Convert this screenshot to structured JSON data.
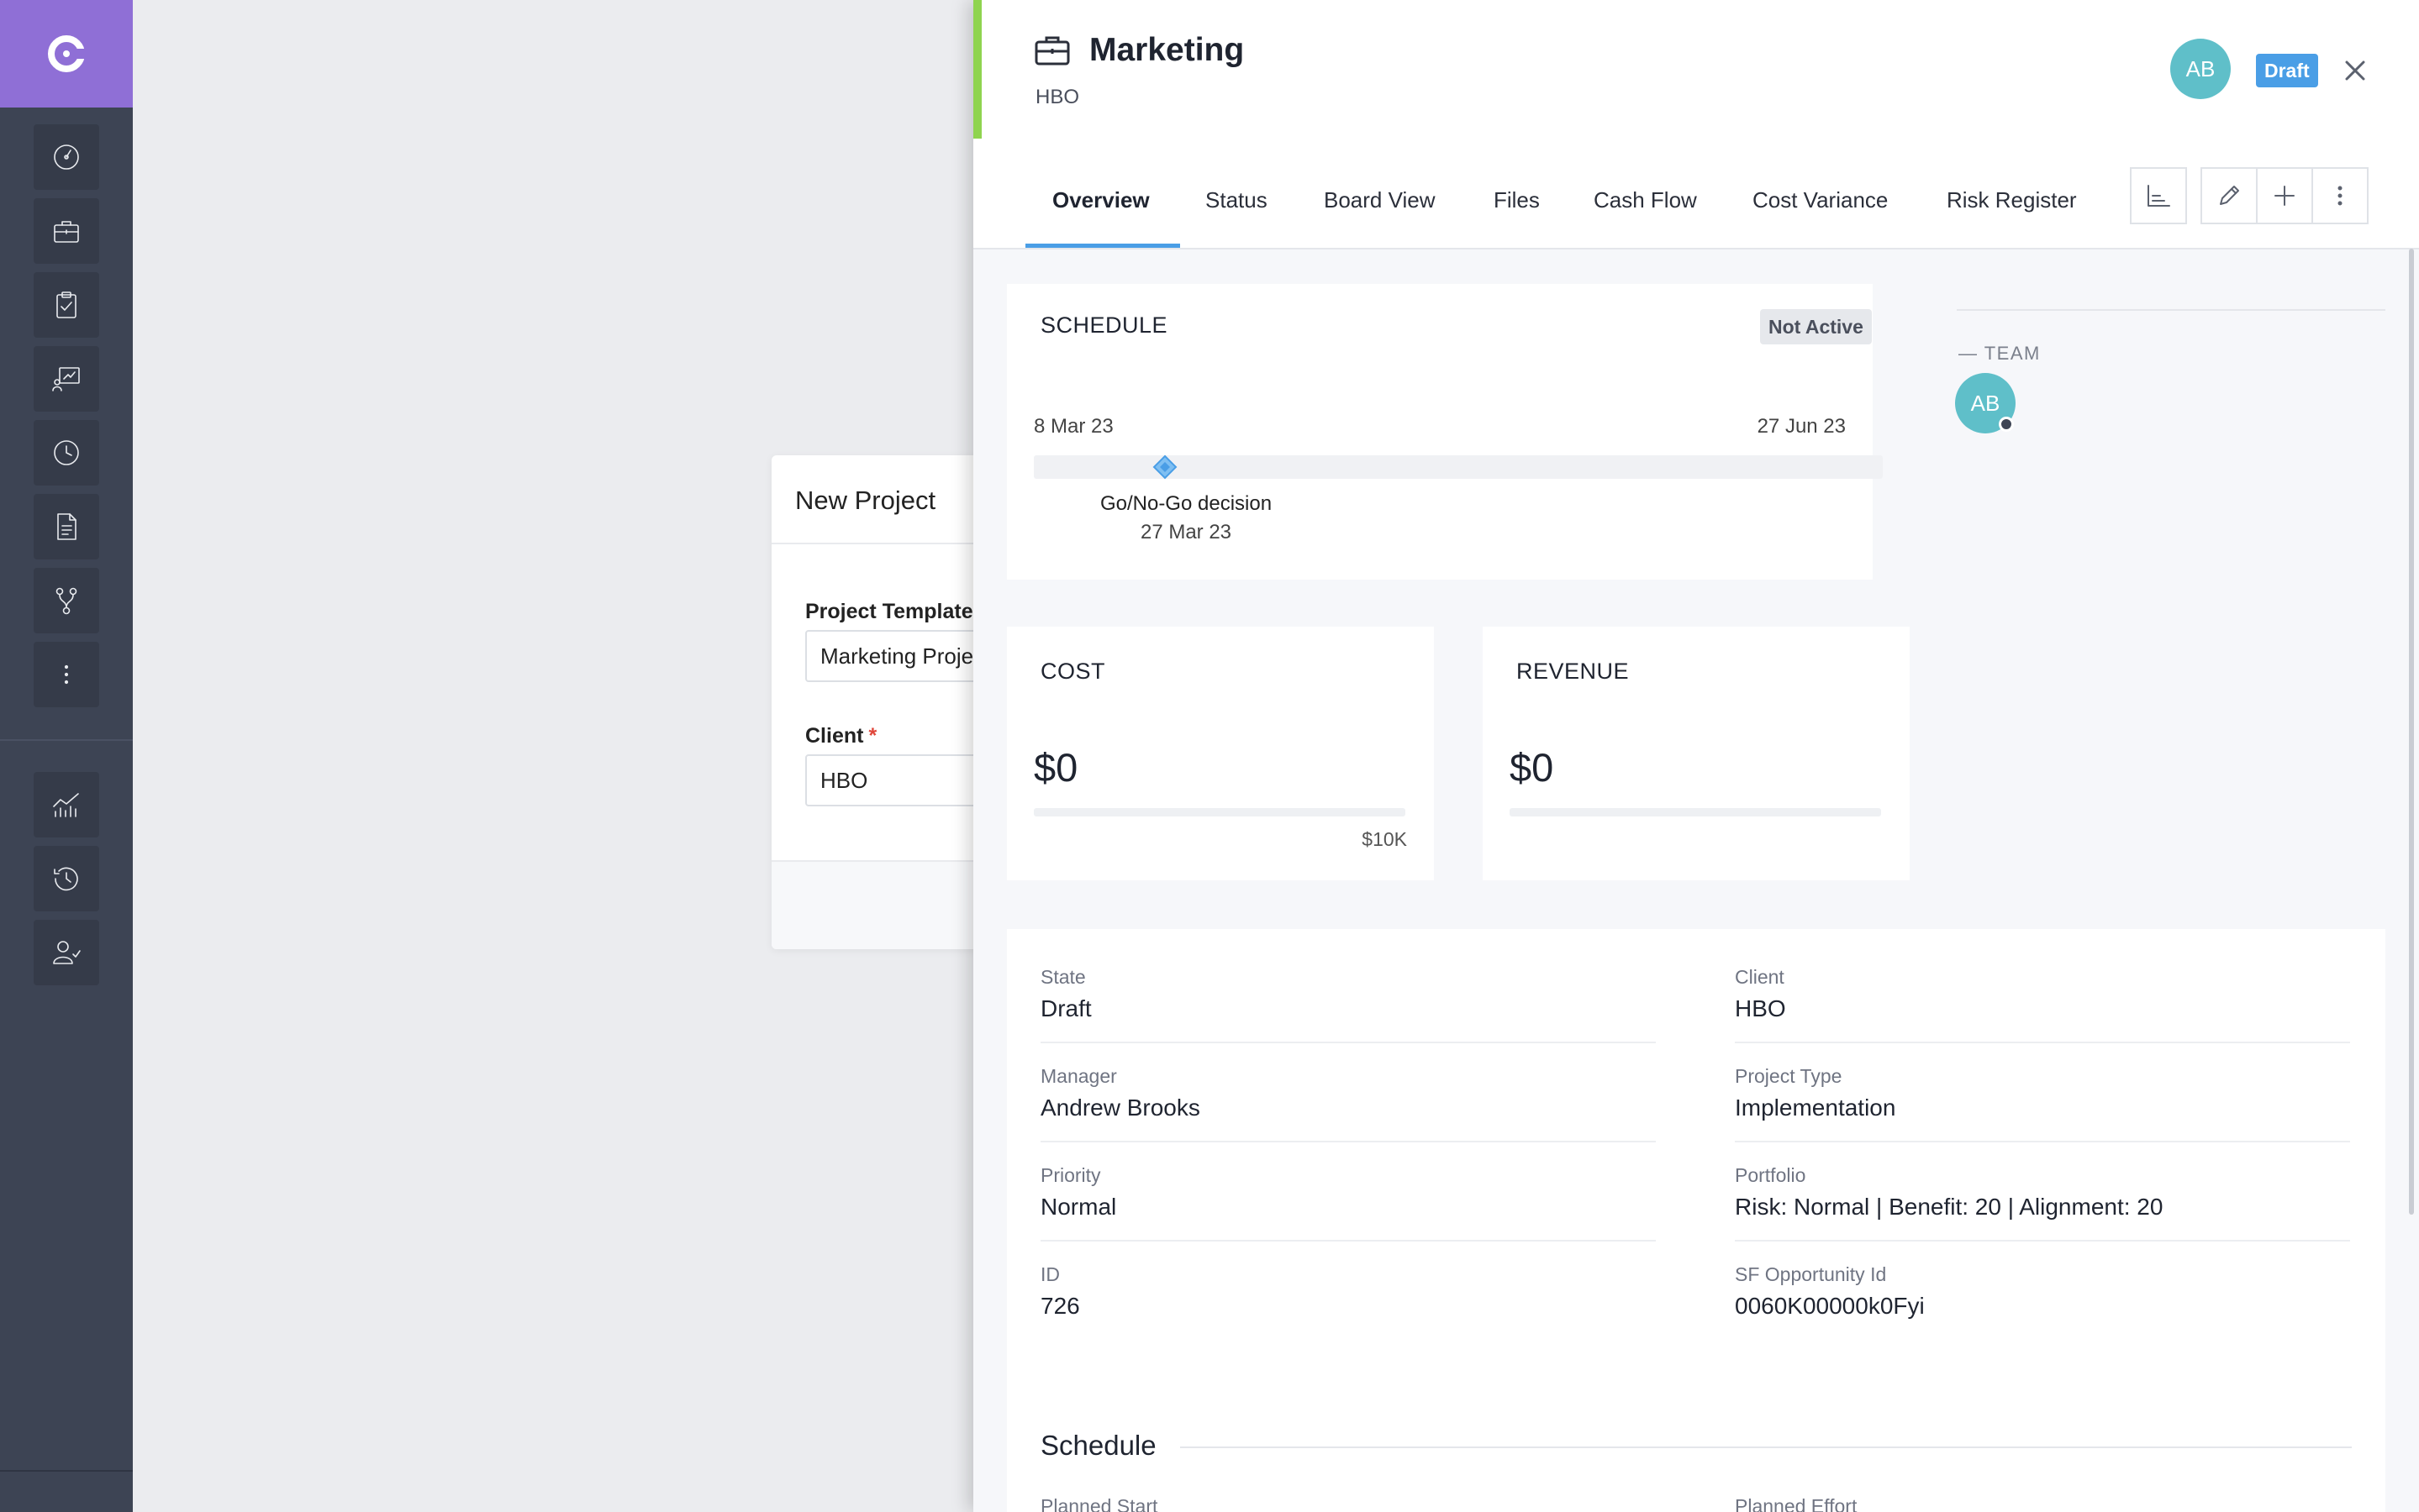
{
  "sidebar": {
    "logo": "app-logo",
    "items": [
      {
        "name": "dashboard-icon"
      },
      {
        "name": "projects-icon"
      },
      {
        "name": "tasks-icon"
      },
      {
        "name": "reports-icon"
      },
      {
        "name": "timesheet-icon"
      },
      {
        "name": "documents-icon"
      },
      {
        "name": "workflow-icon"
      },
      {
        "name": "more-icon"
      },
      {
        "name": "analytics-icon"
      },
      {
        "name": "history-icon"
      },
      {
        "name": "user-check-icon"
      }
    ],
    "colors": {
      "bg": "#3d4454",
      "logo_bg": "#8f6fd6"
    }
  },
  "new_project_dialog": {
    "title": "New Project",
    "template_label": "Project Template",
    "template_value": "Marketing Proje",
    "client_label": "Client",
    "required_mark": "*",
    "client_value": "HBO"
  },
  "panel": {
    "title": "Marketing",
    "client": "HBO",
    "avatar_initials": "AB",
    "status_badge": "Draft",
    "accent_color": "#8fd44f",
    "tabs": [
      "Overview",
      "Status",
      "Board View",
      "Files",
      "Cash Flow",
      "Cost Variance",
      "Risk Register"
    ],
    "active_tab": "Overview",
    "toolbar": [
      "chart-icon",
      "edit-icon",
      "add-icon",
      "more-vertical-icon"
    ]
  },
  "schedule_card": {
    "title": "SCHEDULE",
    "status": "Not Active",
    "start_date": "8 Mar 23",
    "end_date": "27 Jun 23",
    "milestone_name": "Go/No-Go decision",
    "milestone_date": "27 Mar 23"
  },
  "team": {
    "label": "— TEAM",
    "members": [
      "AB"
    ]
  },
  "cost_card": {
    "title": "COST",
    "value": "$0",
    "max": "$10K"
  },
  "revenue_card": {
    "title": "REVENUE",
    "value": "$0"
  },
  "details": {
    "fields": [
      {
        "label": "State",
        "value": "Draft"
      },
      {
        "label": "Client",
        "value": "HBO"
      },
      {
        "label": "Manager",
        "value": "Andrew Brooks"
      },
      {
        "label": "Project Type",
        "value": "Implementation"
      },
      {
        "label": "Priority",
        "value": "Normal"
      },
      {
        "label": "Portfolio",
        "value": "Risk: Normal | Benefit: 20 | Alignment: 20"
      },
      {
        "label": "ID",
        "value": "726"
      },
      {
        "label": "SF Opportunity Id",
        "value": "0060K00000k0Fyi"
      }
    ],
    "schedule_heading": "Schedule",
    "planned_start_label": "Planned Start",
    "planned_effort_label": "Planned Effort"
  }
}
